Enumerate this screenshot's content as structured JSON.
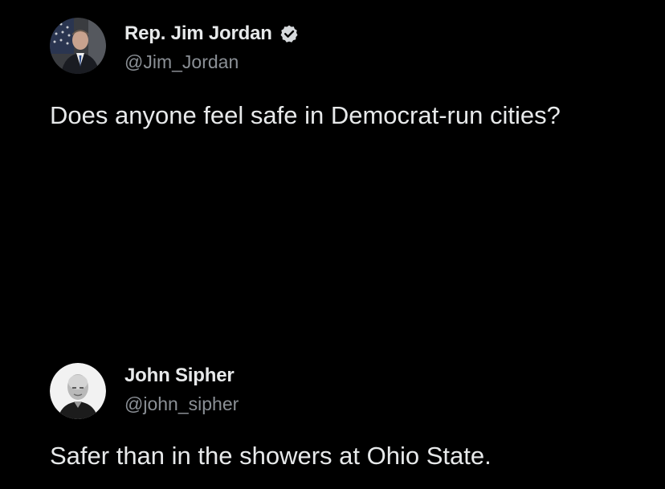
{
  "tweets": [
    {
      "display_name": "Rep. Jim Jordan",
      "handle": "@Jim_Jordan",
      "verified": true,
      "text": "Does anyone feel safe in Democrat-run cities?",
      "avatar_icon": "profile-photo-suit-flag"
    },
    {
      "display_name": "John Sipher",
      "handle": "@john_sipher",
      "verified": false,
      "text": "Safer than in the showers at Ohio State.",
      "avatar_icon": "profile-photo-bw-portrait"
    }
  ],
  "colors": {
    "background": "#000000",
    "primary_text": "#e7e9ea",
    "secondary_text": "#8b9096",
    "verified_badge": "#d6d9dc"
  }
}
